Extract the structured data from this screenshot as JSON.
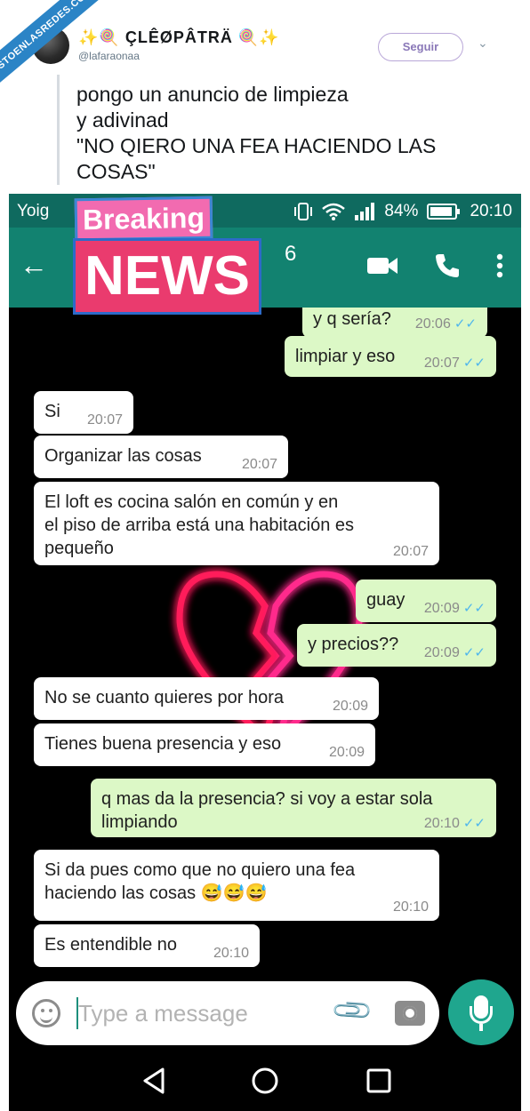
{
  "watermark": "VISTOENLASREDES.COM",
  "tweet": {
    "display_name": "✨🍭 ÇLÊØPÂTRÄ 🍭✨",
    "handle": "@lafaraonaa",
    "follow_label": "Seguir",
    "chevron": "⌄",
    "lines": [
      "pongo un anuncio de limpieza",
      "y adivinad",
      "\"NO QIERO UNA FEA HACIENDO LAS",
      "COSAS\""
    ]
  },
  "status_bar": {
    "carrier": "Yoig",
    "battery": "84%",
    "time": "20:10"
  },
  "app_bar": {
    "contact_fragment": "6"
  },
  "sticker": {
    "line1": "Breaking",
    "line2": "NEWS"
  },
  "messages": [
    {
      "dir": "out",
      "text": [
        "y q sería?"
      ],
      "time": "20:06",
      "ticks": "✓✓"
    },
    {
      "dir": "out",
      "text": [
        "limpiar y eso"
      ],
      "time": "20:07",
      "ticks": "✓✓"
    },
    {
      "dir": "in",
      "text": [
        "Si"
      ],
      "time": "20:07"
    },
    {
      "dir": "in",
      "text": [
        "Organizar las cosas"
      ],
      "time": "20:07"
    },
    {
      "dir": "in",
      "text": [
        "El loft es cocina salón en común y en",
        "el piso de arriba está una habitación es",
        "pequeño"
      ],
      "time": "20:07"
    },
    {
      "dir": "out",
      "text": [
        "guay"
      ],
      "time": "20:09",
      "ticks": "✓✓"
    },
    {
      "dir": "out",
      "text": [
        "y precios??"
      ],
      "time": "20:09",
      "ticks": "✓✓"
    },
    {
      "dir": "in",
      "text": [
        "No se cuanto quieres por hora"
      ],
      "time": "20:09"
    },
    {
      "dir": "in",
      "text": [
        "Tienes buena presencia y eso"
      ],
      "time": "20:09"
    },
    {
      "dir": "out",
      "text": [
        "q mas da la presencia? si voy a estar sola",
        "limpiando"
      ],
      "time": "20:10",
      "ticks": "✓✓"
    },
    {
      "dir": "in",
      "text": [
        "Si da pues como que no quiero una fea",
        "haciendo las cosas 😅😅😅"
      ],
      "time": "20:10"
    },
    {
      "dir": "in",
      "text": [
        "Es entendible no"
      ],
      "time": "20:10"
    }
  ],
  "input": {
    "placeholder": "Type a message"
  },
  "icons": {
    "back": "arrow-left-icon",
    "video": "video-call-icon",
    "call": "phone-call-icon",
    "menu": "more-vert-icon",
    "emoji": "emoji-icon",
    "attach": "paperclip-icon",
    "camera": "camera-icon",
    "mic": "microphone-icon"
  },
  "colors": {
    "status_bar": "#0f6a5f",
    "app_bar": "#128270",
    "outgoing_bubble": "#dcf8c6",
    "incoming_bubble": "#ffffff",
    "read_ticks": "#4fb6ec",
    "mic_button": "#1fa68e"
  }
}
